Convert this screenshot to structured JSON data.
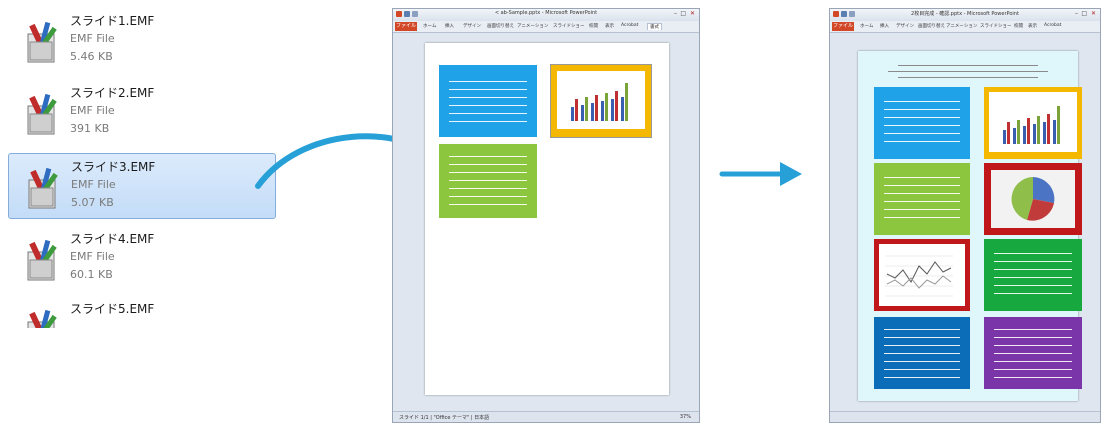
{
  "file_list": [
    {
      "name": "スライド1.EMF",
      "type": "EMF File",
      "size": "5.46 KB",
      "selected": false
    },
    {
      "name": "スライド2.EMF",
      "type": "EMF File",
      "size": "391 KB",
      "selected": false
    },
    {
      "name": "スライド3.EMF",
      "type": "EMF File",
      "size": "5.07 KB",
      "selected": true
    },
    {
      "name": "スライド4.EMF",
      "type": "EMF File",
      "size": "60.1 KB",
      "selected": false
    },
    {
      "name": "スライド5.EMF",
      "type": "",
      "size": "",
      "selected": false
    }
  ],
  "window_before": {
    "title": "< ab-Sample.pptx - Microsoft PowerPoint",
    "file_tab": "ファイル",
    "tabs": [
      "ホーム",
      "挿入",
      "デザイン",
      "画面切り替え",
      "アニメーション",
      "スライドショー",
      "校閲",
      "表示",
      "Acrobat",
      "書式"
    ],
    "status": "スライド 1/1 | \"Office テーマ\" | 日本語",
    "zoom": "37%"
  },
  "window_after": {
    "title": "2枚目完成 - 確認.pptx - Microsoft PowerPoint",
    "file_tab": "ファイル",
    "tabs": [
      "ホーム",
      "挿入",
      "デザイン",
      "画面切り替え",
      "アニメーション",
      "スライドショー",
      "校閲",
      "表示",
      "Acrobat"
    ],
    "status": ""
  },
  "colors": {
    "blue": "#1fa2e8",
    "green": "#8cc63f",
    "yellow": "#f5b800",
    "red": "#c0171b",
    "green_dark": "#17a83f",
    "navy": "#0b6db8",
    "purple": "#7a36a8",
    "arrow": "#27a0d8",
    "selection": "#cde4fb"
  },
  "icons": {
    "file": "emf-file-icon",
    "drag_arrow": "curved-arrow-icon",
    "flow_arrow": "right-arrow-icon"
  }
}
